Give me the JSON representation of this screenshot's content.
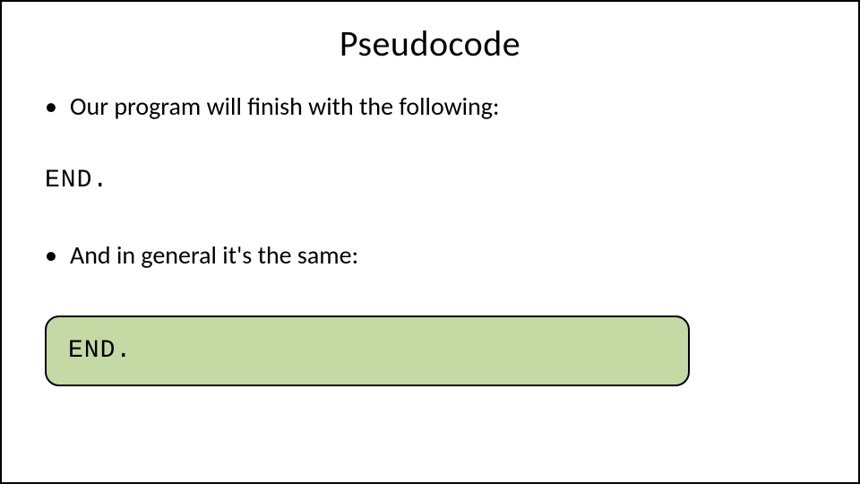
{
  "slide": {
    "title": "Pseudocode",
    "bullets": [
      "Our program will finish with the following:",
      "And in general it's the same:"
    ],
    "code1": "END.",
    "code2": "END."
  }
}
